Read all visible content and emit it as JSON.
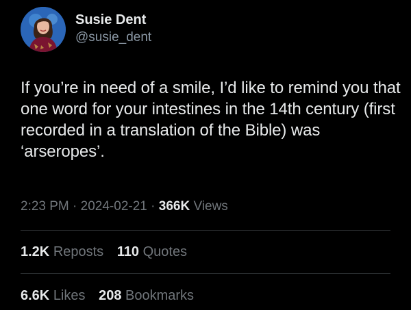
{
  "author": {
    "display_name": "Susie Dent",
    "handle": "@susie_dent",
    "avatar_icon": "profile-photo-avatar"
  },
  "tweet": {
    "text": "If you’re in need of a smile, I’d like to remind you that one word for your intestines in the 14th century (first recorded in a translation of the Bible) was ‘arseropes’.",
    "time": "2:23 PM",
    "date": "2024-02-21",
    "separator": "·",
    "views_count": "366K",
    "views_label": "Views"
  },
  "stats": {
    "reposts_count": "1.2K",
    "reposts_label": "Reposts",
    "quotes_count": "110",
    "quotes_label": "Quotes",
    "likes_count": "6.6K",
    "likes_label": "Likes",
    "bookmarks_count": "208",
    "bookmarks_label": "Bookmarks"
  },
  "colors": {
    "background": "#000000",
    "primary_text": "#e7e9ea",
    "secondary_text": "#71767b",
    "divider": "#2f3336"
  }
}
